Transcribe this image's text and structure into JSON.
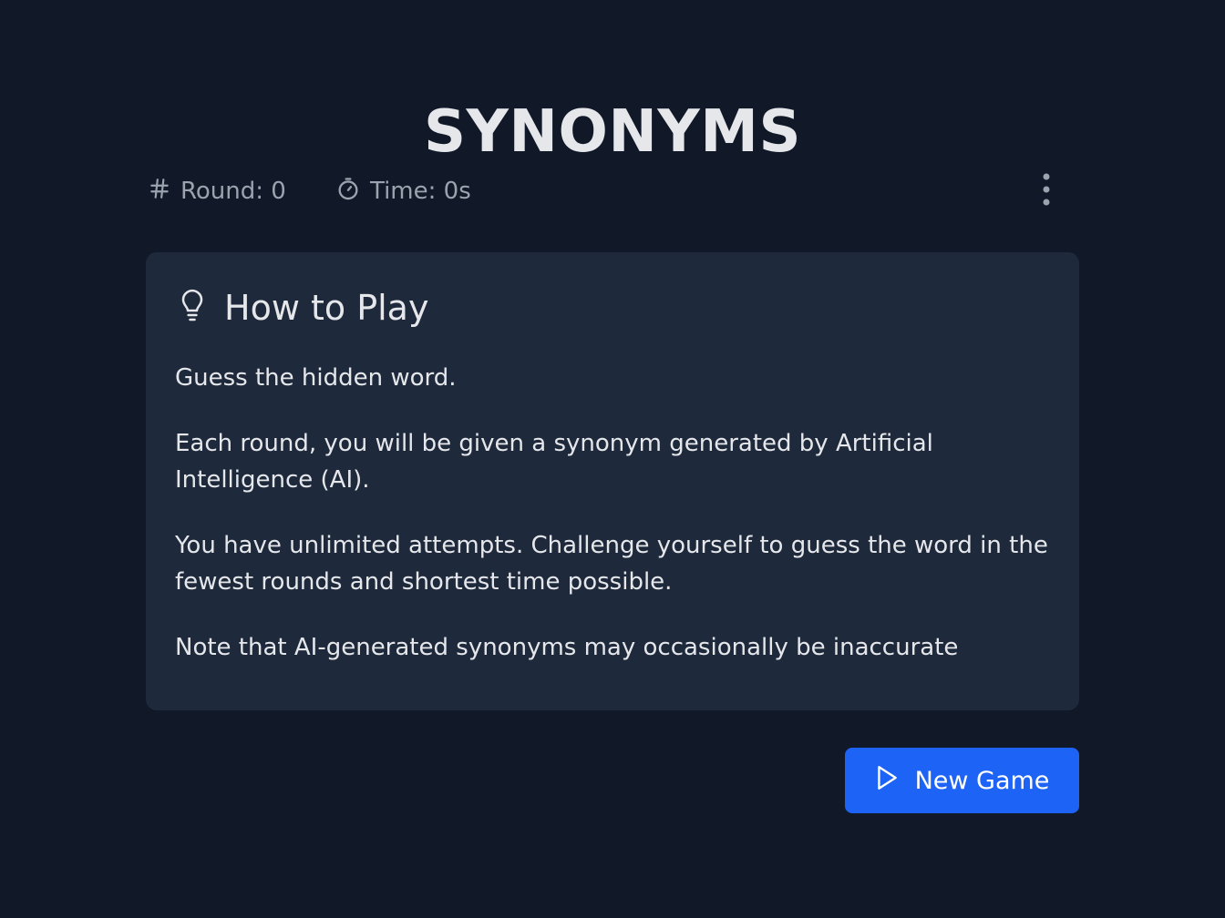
{
  "header": {
    "title": "SYNONYMS"
  },
  "stats": {
    "round_label": "Round: 0",
    "time_label": "Time: 0s",
    "round_icon": "hash-icon",
    "time_icon": "stopwatch-icon",
    "menu_icon": "more-vertical-icon"
  },
  "how_to_play": {
    "title": "How to Play",
    "icon": "lightbulb-icon",
    "paragraphs": [
      "Guess the hidden word.",
      "Each round, you will be given a synonym generated by Artificial Intelligence (AI).",
      "You have unlimited attempts. Challenge yourself to guess the word in the fewest rounds and shortest time possible.",
      "Note that AI-generated synonyms may occasionally be inaccurate"
    ]
  },
  "actions": {
    "new_game_label": "New Game",
    "new_game_icon": "play-icon"
  },
  "colors": {
    "background": "#111827",
    "card": "#1e293b",
    "accent": "#1d63f5",
    "muted_text": "#9ca3af",
    "text": "#e5e7eb"
  }
}
